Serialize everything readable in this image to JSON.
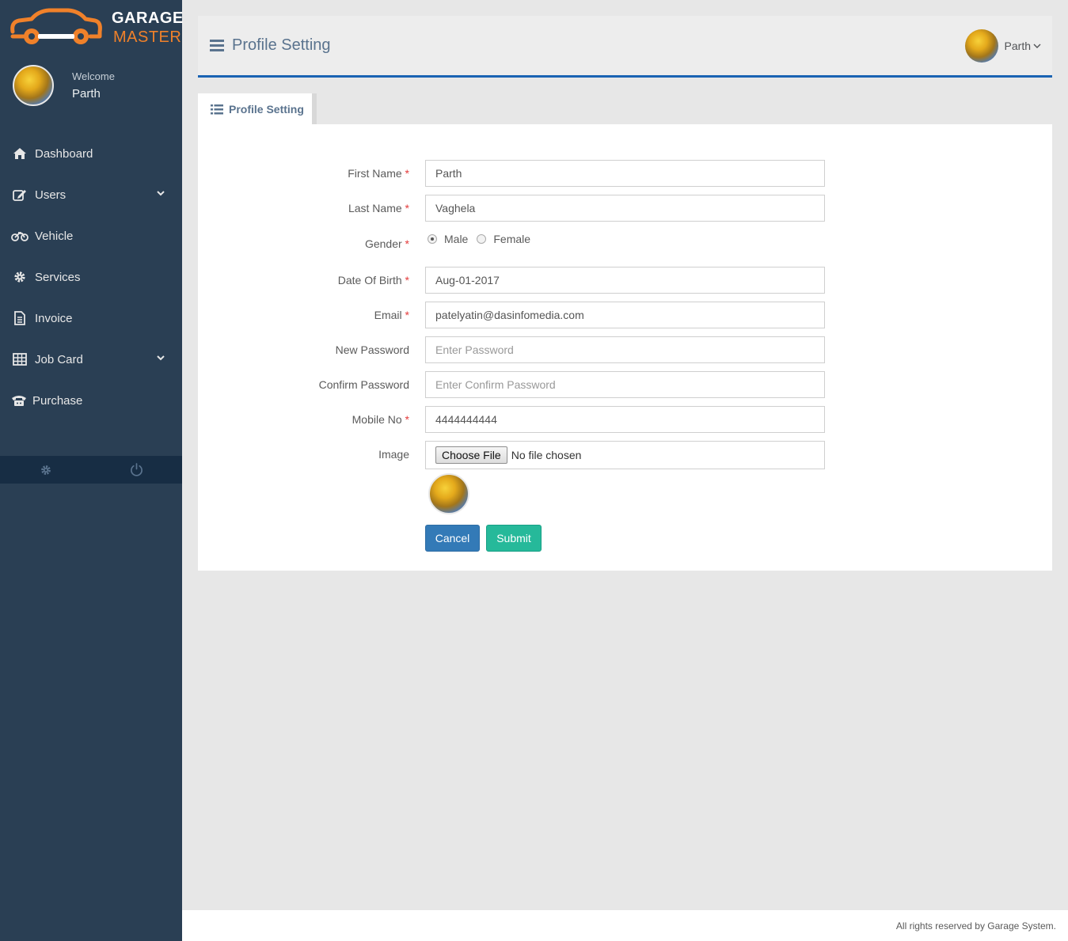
{
  "brand": {
    "line1": "GARAGE",
    "line2": "MASTER"
  },
  "sidebar": {
    "welcome": "Welcome",
    "user_name": "Parth",
    "items": [
      {
        "label": "Dashboard",
        "icon": "home-icon"
      },
      {
        "label": "Users",
        "icon": "edit-icon"
      },
      {
        "label": "Vehicle",
        "icon": "motorcycle-icon"
      },
      {
        "label": "Services",
        "icon": "gear-icon"
      },
      {
        "label": "Invoice",
        "icon": "document-icon"
      },
      {
        "label": "Job Card",
        "icon": "table-icon"
      },
      {
        "label": "Purchase",
        "icon": "phone-icon"
      }
    ],
    "footer_icons": [
      "settings-icon",
      "power-icon"
    ]
  },
  "header": {
    "title": "Profile Setting",
    "user_name": "Parth"
  },
  "tab": {
    "label": "Profile Setting"
  },
  "form": {
    "first_name": {
      "label": "First Name",
      "value": "Parth"
    },
    "last_name": {
      "label": "Last Name",
      "value": "Vaghela"
    },
    "gender": {
      "label": "Gender",
      "options": [
        "Male",
        "Female"
      ],
      "selected": "Male"
    },
    "dob": {
      "label": "Date Of Birth",
      "value": "Aug-01-2017"
    },
    "email": {
      "label": "Email",
      "value": "patelyatin@dasinfomedia.com"
    },
    "new_password": {
      "label": "New Password",
      "placeholder": "Enter Password"
    },
    "confirm_password": {
      "label": "Confirm Password",
      "placeholder": "Enter Confirm Password"
    },
    "mobile": {
      "label": "Mobile No",
      "value": "4444444444"
    },
    "image": {
      "label": "Image",
      "button": "Choose File",
      "status": "No file chosen"
    },
    "required_mark": "*",
    "cancel_label": "Cancel",
    "submit_label": "Submit"
  },
  "footer": {
    "text": "All rights reserved by Garage System."
  },
  "colors": {
    "sidebar": "#2a3f54",
    "accent": "#1a63b3",
    "cancel": "#337ab7",
    "submit": "#26b99a",
    "brand_orange": "#f0812a"
  }
}
